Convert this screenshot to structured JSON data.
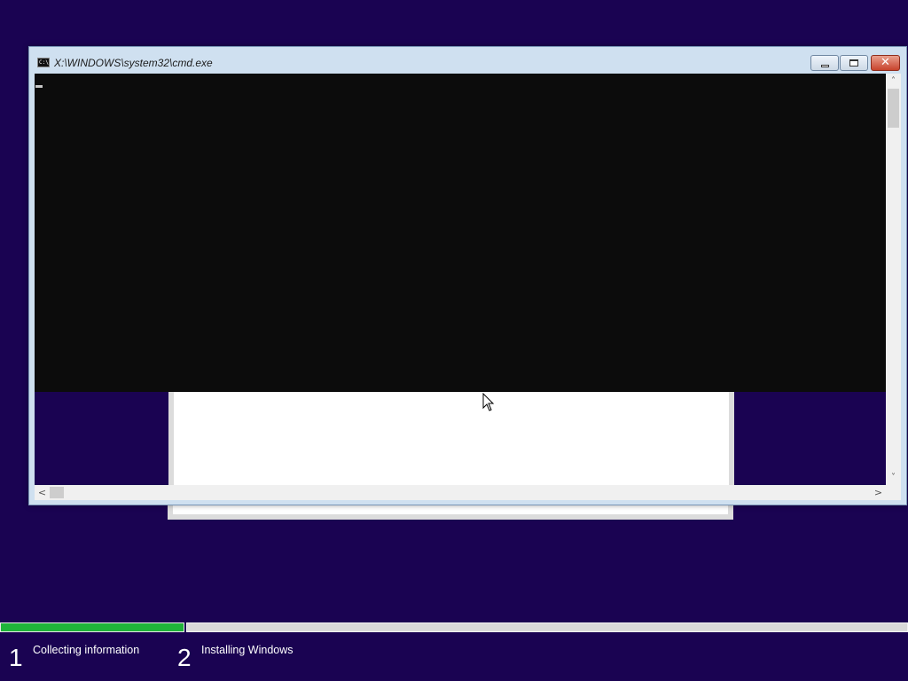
{
  "console_window": {
    "title": "X:\\WINDOWS\\system32\\cmd.exe",
    "icon": "cmd-icon",
    "icon_text": "C:\\",
    "close_glyph": "✕"
  },
  "scrollbar_glyphs": {
    "up": "˄",
    "down": "˅",
    "left": "<",
    "right": ">"
  },
  "setup": {
    "progress_complete": 0.2,
    "steps": [
      {
        "number": "1",
        "label": "Collecting information"
      },
      {
        "number": "2",
        "label": "Installing Windows"
      }
    ]
  },
  "colors": {
    "background": "#1a0352",
    "console_bg": "#0c0c0c",
    "progress_done": "#1fb33a",
    "progress_remaining": "#d9d9d9"
  }
}
